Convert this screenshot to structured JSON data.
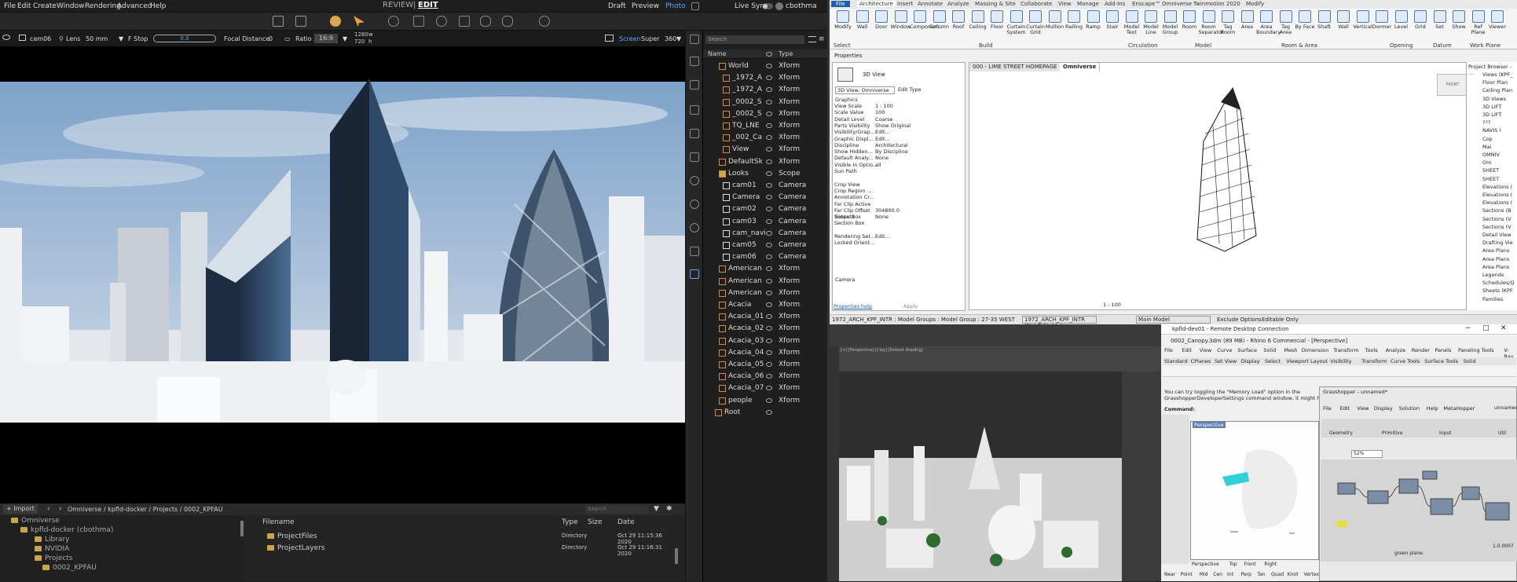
{
  "omniverse": {
    "menu": [
      "File",
      "Edit",
      "Create",
      "Window",
      "Rendering",
      "Advanced",
      "Help"
    ],
    "mode": {
      "review": "REVIEW",
      "separator": "|",
      "edit": "EDIT"
    },
    "render_modes": [
      "Draft",
      "Preview",
      "Photo"
    ],
    "live_sync": "Live Sync",
    "user": "cbothma",
    "viewport_bar": {
      "camera": "cam06",
      "lens_label": "Lens",
      "lens_value": "50 mm",
      "fstop_label": "F Stop",
      "fstop_value": "0.0",
      "focal_label": "Focal Distance",
      "focal_value": "0",
      "ratio_label": "Ratio",
      "ratio_value": "16:9",
      "width": "1280",
      "height": "720",
      "w": "w",
      "h": "h",
      "screen": "Screen",
      "quality": "Super",
      "angle": "360"
    },
    "stage": {
      "search_placeholder": "Search",
      "col_name": "Name",
      "col_type": "Type",
      "rows": [
        {
          "name": "World",
          "type": "Xform"
        },
        {
          "name": "_1972_A",
          "type": "Xform"
        },
        {
          "name": "_1972_A",
          "type": "Xform"
        },
        {
          "name": "_0002_S",
          "type": "Xform"
        },
        {
          "name": "_0002_S",
          "type": "Xform"
        },
        {
          "name": "TQ_LNE",
          "type": "Xform"
        },
        {
          "name": "_002_Ca",
          "type": "Xform"
        },
        {
          "name": "View",
          "type": "Xform"
        },
        {
          "name": "DefaultSk",
          "type": "Xform"
        },
        {
          "name": "Looks",
          "type": "Scope"
        },
        {
          "name": "cam01",
          "type": "Camera"
        },
        {
          "name": "Camera",
          "type": "Camera"
        },
        {
          "name": "cam02",
          "type": "Camera"
        },
        {
          "name": "cam03",
          "type": "Camera"
        },
        {
          "name": "cam_navi",
          "type": "Camera"
        },
        {
          "name": "cam05",
          "type": "Camera"
        },
        {
          "name": "cam06",
          "type": "Camera"
        },
        {
          "name": "American",
          "type": "Xform"
        },
        {
          "name": "American",
          "type": "Xform"
        },
        {
          "name": "American",
          "type": "Xform"
        },
        {
          "name": "Acacia",
          "type": "Xform"
        },
        {
          "name": "Acacia_01",
          "type": "Xform"
        },
        {
          "name": "Acacia_02",
          "type": "Xform"
        },
        {
          "name": "Acacia_03",
          "type": "Xform"
        },
        {
          "name": "Acacia_04",
          "type": "Xform"
        },
        {
          "name": "Acacia_05",
          "type": "Xform"
        },
        {
          "name": "Acacia_06",
          "type": "Xform"
        },
        {
          "name": "Acacia_07",
          "type": "Xform"
        },
        {
          "name": "people",
          "type": "Xform"
        },
        {
          "name": "Root",
          "type": ""
        }
      ]
    },
    "content": {
      "import": "Import",
      "path": "Omniverse / kpfld-docker / Projects / 0002_KPFAU",
      "search_placeholder": "Search",
      "tree": [
        "Omniverse",
        "kpfld-docker (cbothma)",
        "Library",
        "NVIDIA",
        "Projects",
        "0002_KPFAU"
      ],
      "cols": {
        "filename": "Filename",
        "type": "Type",
        "size": "Size",
        "date": "Date"
      },
      "files": [
        {
          "name": "ProjectFiles",
          "type": "Directory",
          "date": "Oct 29 11:15:36 2020"
        },
        {
          "name": "ProjectLayers",
          "type": "Directory",
          "date": "Oct 29 11:16:31 2020"
        }
      ]
    }
  },
  "revit": {
    "tabs": [
      "File",
      "Architecture",
      "Insert",
      "Annotate",
      "Analyze",
      "Massing & Site",
      "Collaborate",
      "View",
      "Manage",
      "Add-Ins",
      "Enscape™",
      "Omniverse",
      "Twinmotion 2020",
      "Modify"
    ],
    "buttons": [
      "Modify",
      "Wall",
      "Door",
      "Window",
      "Component",
      "Column",
      "Roof",
      "Ceiling",
      "Floor",
      "Curtain System",
      "Curtain Grid",
      "Mullion",
      "Railing",
      "Ramp",
      "Stair",
      "Model Text",
      "Model Line",
      "Model Group",
      "Room",
      "Room Separator",
      "Tag Room",
      "Area",
      "Area Boundary",
      "Tag Area",
      "By Face",
      "Shaft",
      "Wall",
      "Vertical",
      "Dormer",
      "Level",
      "Grid",
      "Set",
      "Show",
      "Ref Plane",
      "Viewer"
    ],
    "groups": [
      "Select",
      "Build",
      "Circulation",
      "Model",
      "Room & Area",
      "Opening",
      "Datum",
      "Work Plane"
    ],
    "properties_title": "Properties",
    "view_type": "3D View",
    "view_selector": "3D View: Omniverse",
    "edit_type": "Edit Type",
    "sections": {
      "graphics": "Graphics",
      "extents": "Extents",
      "camera": "Camera"
    },
    "props": [
      {
        "k": "View Scale",
        "v": "1 : 100"
      },
      {
        "k": "Scale Value",
        "v": "100"
      },
      {
        "k": "Detail Level",
        "v": "Coarse"
      },
      {
        "k": "Parts Visibility",
        "v": "Show Original"
      },
      {
        "k": "Visibility/Grap...",
        "v": "Edit..."
      },
      {
        "k": "Graphic Displ...",
        "v": "Edit..."
      },
      {
        "k": "Discipline",
        "v": "Architectural"
      },
      {
        "k": "Show Hidden...",
        "v": "By Discipline"
      },
      {
        "k": "Default Analy...",
        "v": "None"
      },
      {
        "k": "Visible In Optio...",
        "v": "all"
      },
      {
        "k": "Sun Path",
        "v": ""
      },
      {
        "k": "Crop View",
        "v": ""
      },
      {
        "k": "Crop Region ...",
        "v": ""
      },
      {
        "k": "Annotation Cr...",
        "v": ""
      },
      {
        "k": "Far Clip Active",
        "v": ""
      },
      {
        "k": "Far Clip Offset",
        "v": "304800.0"
      },
      {
        "k": "Scope Box",
        "v": "None"
      },
      {
        "k": "Section Box",
        "v": ""
      },
      {
        "k": "Rendering Set...",
        "v": "Edit..."
      },
      {
        "k": "Locked Orient...",
        "v": ""
      }
    ],
    "properties_help": "Properties help",
    "apply": "Apply",
    "view_tabs": [
      "000 - LIME STREET HOMEPAGE",
      "Omniverse"
    ],
    "viewcube": "FRONT",
    "view_scale_footer": "1 : 100",
    "browser_title": "Project Browser - ...",
    "browser": [
      "Views (KPF_",
      "Floor Plan",
      "Ceiling Plan",
      "3D Views",
      "3D LIFT",
      "3D LIFT",
      "???",
      "NAVIS I",
      "Cop",
      "Mai",
      "OMNIV",
      "Om",
      "SHEET",
      "SHEET",
      "Elevations (",
      "Elevations (",
      "Elevations (",
      "Sections (B",
      "Sections (V",
      "Sections (V",
      "Detail View",
      "Drafting Vie",
      "Area Plans",
      "Area Plans",
      "Area Plans",
      "Legends",
      "Schedules/Q",
      "Sheets (KPF",
      "Families"
    ],
    "status_left": "1972_ARCH_KPF_INTR : Model Groups : Model Group : 27-35 WEST",
    "status_ws": "1972_ARCH_KPF_INTR (Not Editable)",
    "status_model": "Main Model",
    "exclude": "Exclude Options",
    "editable": "Editable Only"
  },
  "max": {
    "viewport_label": "[+] [Perspective] [Clay] [Default Shading]"
  },
  "rhino": {
    "rdp_title": "kpfld-dev01 - Remote Desktop Connection",
    "title": "0002_Canopy.3dm (89 MB) - Rhino 6 Commercial - [Perspective]",
    "menu": [
      "File",
      "Edit",
      "View",
      "Curve",
      "Surface",
      "Solid",
      "Mesh",
      "Dimension",
      "Transform",
      "Tools",
      "Analyze",
      "Render",
      "Panels",
      "Paneling Tools",
      "V-Ray",
      "Help"
    ],
    "tabs": [
      "Standard",
      "CPlanes",
      "Set View",
      "Display",
      "Select",
      "Viewport Layout",
      "Visibility",
      "Transform",
      "Curve Tools",
      "Surface Tools",
      "Solid"
    ],
    "msg1": "You can try toggling the \"Memory Load\" option in the",
    "msg2": "GrasshopperDeveloperSettings command window, it might help.",
    "command": "Command:",
    "perspective": "Perspective",
    "view_tabs": [
      "Perspective",
      "Top",
      "Front",
      "Right"
    ],
    "osnaps": [
      "Near",
      "Point",
      "Mid",
      "Cen",
      "Int",
      "Perp",
      "Tan",
      "Quad",
      "Knot",
      "Vertex",
      "Project",
      "Disable"
    ]
  },
  "grasshopper": {
    "title": "Grasshopper - unnamed*",
    "menu": [
      "File",
      "Edit",
      "View",
      "Display",
      "Solution",
      "Help",
      "MetaHopper"
    ],
    "doc": "unnamed",
    "groups": [
      "Geometry",
      "Primitive",
      "Input",
      "Util"
    ],
    "zoom": "52%",
    "footer_right": "1.0.0007",
    "green_plane": "green plane"
  }
}
